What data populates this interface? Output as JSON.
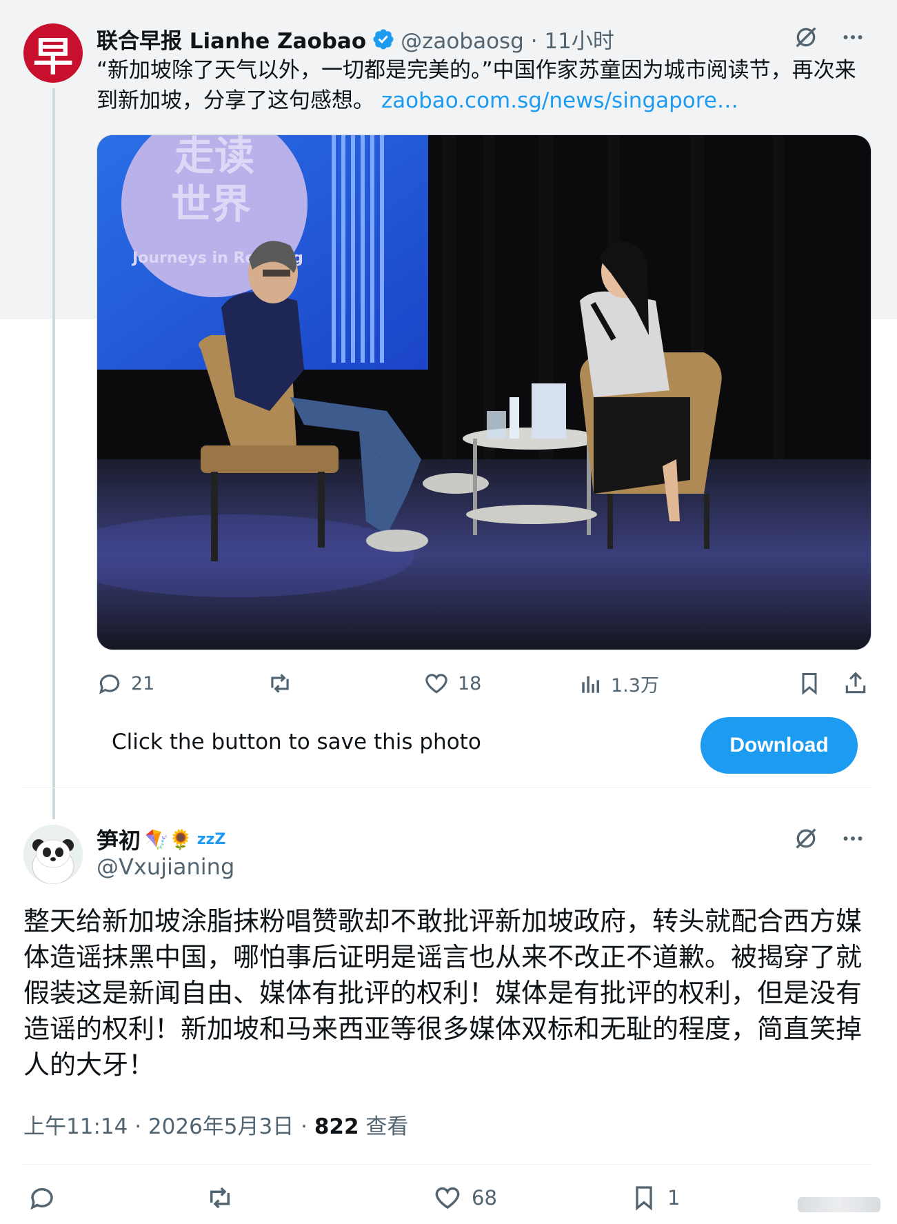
{
  "quoted": {
    "avatar_char": "早",
    "name": "联合早报 Lianhe Zaobao",
    "handle_time": "@zaobaosg · 11小时",
    "text": "“新加坡除了天气以外，一切都是完美的。”中国作家苏童因为城市阅读节，再次来到新加坡，分享了这句感想。",
    "link": "zaobao.com.sg/news/singapore…",
    "photo": {
      "sign_line1": "走读",
      "sign_line2": "世界",
      "sign_arc": "Journeys in Reading"
    },
    "stats": {
      "replies": "21",
      "likes": "18",
      "views": "1.3万"
    },
    "save_prompt": "Click the button to save this photo",
    "download_label": "Download"
  },
  "tweet": {
    "name": "笋初",
    "name_emoji": "🪁🌻",
    "name_suffix": "zzZ",
    "handle": "@Vxujianing",
    "text": "整天给新加坡涂脂抹粉唱赞歌却不敢批评新加坡政府，转头就配合西方媒体造谣抹黑中国，哪怕事后证明是谣言也从来不改正不道歉。被揭穿了就假装这是新闻自由、媒体有批评的权利！媒体是有批评的权利，但是没有造谣的权利！新加坡和马来西亚等很多媒体双标和无耻的程度，简直笑掉人的大牙！",
    "meta_time": "上午11:14 · 2026年5月3日 · ",
    "meta_views": "822",
    "meta_views_label": " 查看",
    "stats": {
      "likes": "68",
      "bookmarks": "1"
    }
  },
  "colors": {
    "accent": "#1d9bf0",
    "brand_red": "#c8102e",
    "muted": "#536471"
  }
}
